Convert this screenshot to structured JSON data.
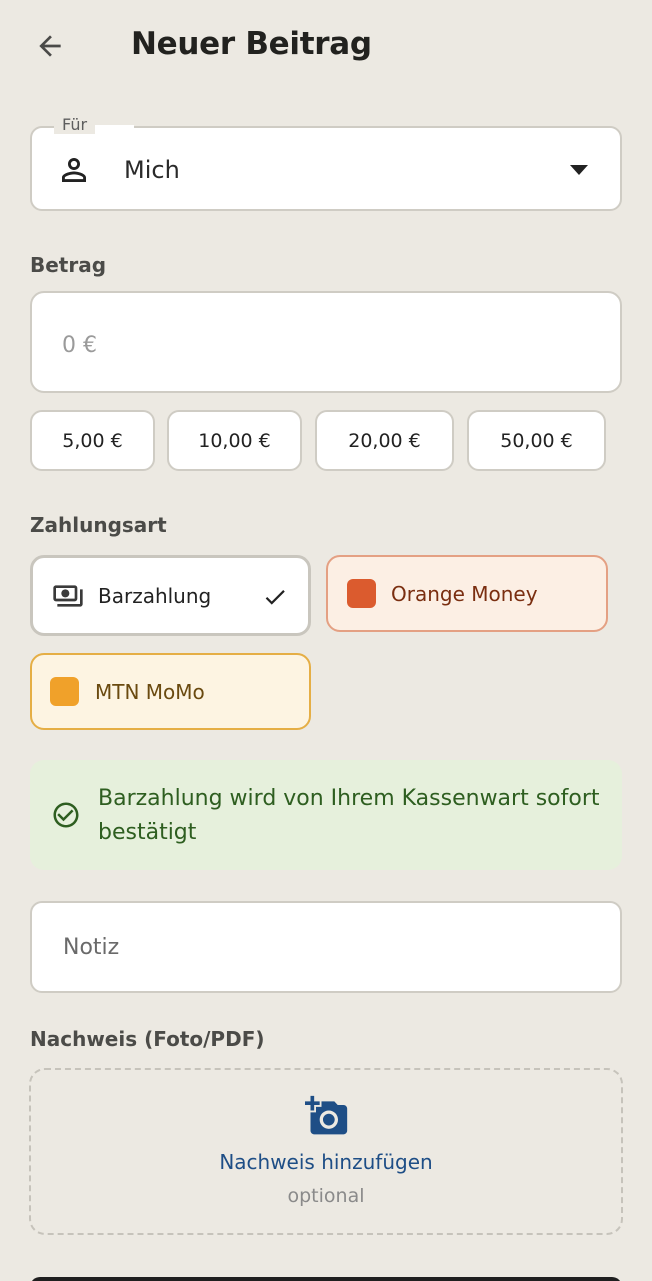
{
  "header": {
    "title": "Neuer Beitrag",
    "back_icon": "arrow-left-icon"
  },
  "for_field": {
    "legend": "Für",
    "value": "Mich",
    "icon": "person-icon"
  },
  "amount": {
    "label": "Betrag",
    "placeholder": "0 €",
    "presets": [
      "5,00 €",
      "10,00 €",
      "20,00 €",
      "50,00 €"
    ]
  },
  "payment": {
    "label": "Zahlungsart",
    "methods": [
      {
        "label": "Barzahlung",
        "icon": "cash-icon",
        "selected": true
      },
      {
        "label": "Orange Money",
        "color": "#DB5B2E",
        "text_color": "#7A2E10"
      },
      {
        "label": "MTN MoMo",
        "color": "#F0A12A",
        "text_color": "#6A4A10"
      }
    ]
  },
  "info": {
    "text": "Barzahlung wird von Ihrem Kassenwart sofort bestätigt",
    "icon": "check-circle-icon"
  },
  "note": {
    "placeholder": "Notiz"
  },
  "proof": {
    "label": "Nachweis (Foto/PDF)",
    "add_label": "Nachweis hinzufügen",
    "hint": "optional",
    "icon": "add-photo-icon"
  },
  "colors": {
    "accent": "#1E4E86",
    "success": "#2E5E20",
    "background": "#ECE9E2"
  }
}
